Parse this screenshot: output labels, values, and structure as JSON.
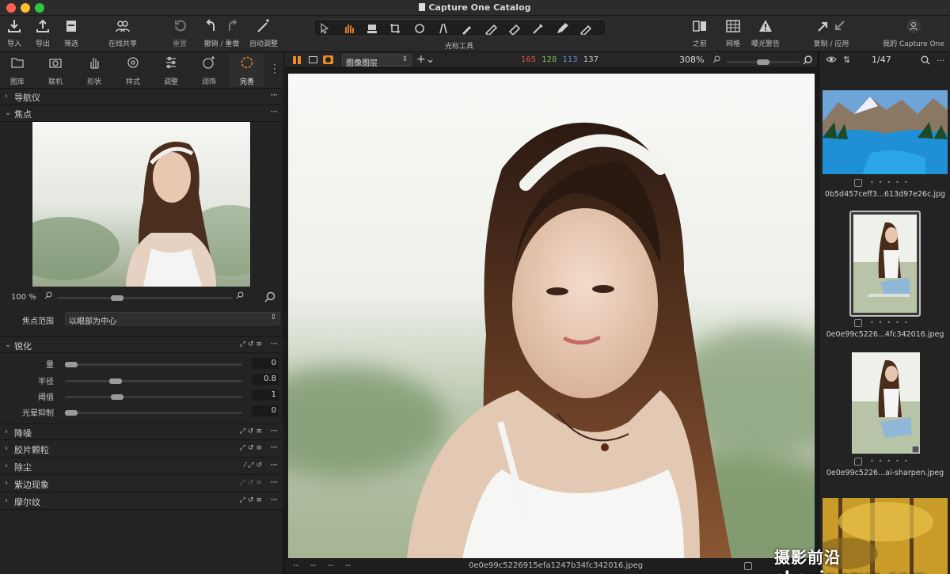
{
  "window": {
    "title": "Capture One Catalog"
  },
  "colors": {
    "accent": "#f08a24",
    "red": "#e0533f",
    "green": "#7fc15a",
    "blue": "#6a8ee6"
  },
  "toolbar": {
    "import": "导入",
    "export": "导出",
    "filter": "筛选",
    "share": "在线共享",
    "reset": "重置",
    "undo_redo": "撤销 / 重做",
    "auto_adjust": "自动调整",
    "cursor_tools": "光标工具",
    "before": "之前",
    "grid": "网格",
    "exposure_warning": "曝光警告",
    "copy_apply": "复制 / 应用",
    "my_capture_one": "我的 Capture One"
  },
  "tool_tabs": [
    {
      "label": "图库",
      "icon": "folder-icon"
    },
    {
      "label": "联机",
      "icon": "camera-icon"
    },
    {
      "label": "形状",
      "icon": "hand-icon"
    },
    {
      "label": "样式",
      "icon": "style-icon"
    },
    {
      "label": "调整",
      "icon": "sliders-icon"
    },
    {
      "label": "润饰",
      "icon": "sparkle-face-icon"
    },
    {
      "label": "完善",
      "icon": "aperture-icon"
    }
  ],
  "navigator": {
    "title": "导航仪"
  },
  "focus": {
    "title": "焦点",
    "zoom": "100 %",
    "zoom_fraction": 0.33,
    "range_label": "焦点范围",
    "range_value": "以眼部为中心"
  },
  "sharpening": {
    "title": "锐化",
    "rows": [
      {
        "label": "量",
        "value": "0",
        "level": 0.0
      },
      {
        "label": "半径",
        "value": "0.8",
        "level": 0.27
      },
      {
        "label": "阈值",
        "value": "1",
        "level": 0.28
      },
      {
        "label": "光晕抑制",
        "value": "0",
        "level": 0.0
      }
    ]
  },
  "sections": [
    "降噪",
    "胶片颗粒",
    "除尘",
    "紫边现象",
    "摩尔纹"
  ],
  "viewer": {
    "layer": "图像图层",
    "rgb": {
      "r": "165",
      "g": "128",
      "b": "113",
      "l": "137"
    },
    "zoom": "308%",
    "zoom_fraction": 0.5,
    "filename": "0e0e99c5226915efa1247b34fc342016.jpeg",
    "foot_left": [
      "--",
      "--",
      "--",
      "--"
    ]
  },
  "browser": {
    "counter": "1/47",
    "thumbs": [
      {
        "caption": "0b5d457ceff3...613d97e26c.jpg"
      },
      {
        "caption": "0e0e99c5226...4fc342016.jpeg"
      },
      {
        "caption": "0e0e99c5226...ai-sharpen.jpeg"
      }
    ]
  },
  "watermark": "摄影前沿 sheyingzyz.com"
}
